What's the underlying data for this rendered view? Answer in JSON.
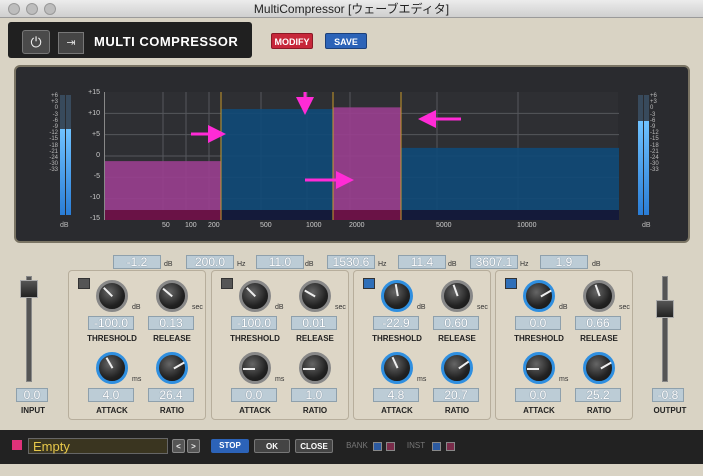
{
  "window": {
    "title": "MultiCompressor [ウェーブエディタ]"
  },
  "header": {
    "plugin_name": "MULTI COMPRESSOR",
    "modify_label": "MODIFY",
    "save_label": "SAVE",
    "power_icon": "power-icon",
    "dropdown_icon": "dropdown-icon"
  },
  "meter_scale": [
    "+6",
    "+3",
    "0",
    "-3",
    "-6",
    "-9",
    "-12",
    "-15",
    "-18",
    "-21",
    "-24",
    "-30",
    "-33"
  ],
  "meter_db": "dB",
  "input_level": 0.72,
  "output_level": 0.78,
  "graph": {
    "y_ticks": [
      "+15",
      "+10",
      "+5",
      "0",
      "-5",
      "-10",
      "-15"
    ],
    "x_ticks": [
      "50",
      "100",
      "200",
      "500",
      "1000",
      "2000",
      "5000",
      "10000"
    ],
    "band_levels_db": [
      -1.2,
      11.0,
      11.4,
      1.9
    ]
  },
  "crossovers": [
    {
      "gain": "-1.2",
      "gain_unit": "dB",
      "freq": "200.0",
      "freq_unit": "Hz"
    },
    {
      "gain": "11.0",
      "gain_unit": "dB",
      "freq": "1530.6",
      "freq_unit": "Hz"
    },
    {
      "gain": "11.4",
      "gain_unit": "dB",
      "freq": "3607.1",
      "freq_unit": "Hz"
    },
    {
      "gain": "1.9",
      "gain_unit": "dB"
    }
  ],
  "bands": [
    {
      "threshold": "-100.0",
      "release": "0.13",
      "attack": "4.0",
      "ratio": "26.4"
    },
    {
      "threshold": "-100.0",
      "release": "0.01",
      "attack": "0.0",
      "ratio": "1.0"
    },
    {
      "threshold": "-22.9",
      "release": "0.60",
      "attack": "4.8",
      "ratio": "20.7"
    },
    {
      "threshold": "0.0",
      "release": "0.66",
      "attack": "0.0",
      "ratio": "25.2"
    }
  ],
  "labels": {
    "threshold": "THRESHOLD",
    "release": "RELEASE",
    "attack": "ATTACK",
    "ratio": "RATIO",
    "db": "dB",
    "sec": "sec",
    "ms": "ms"
  },
  "input": {
    "label": "INPUT",
    "value": "0.0"
  },
  "output": {
    "label": "OUTPUT",
    "value": "-0.8"
  },
  "footer": {
    "preset_name": "Empty",
    "stop": "STOP",
    "ok": "OK",
    "close": "CLOSE",
    "bank": "BANK",
    "inst": "INST",
    "prev": "<",
    "next": ">"
  },
  "colors": {
    "band_fill": "#0f4a78",
    "highlight": "#9a3f8f",
    "accent_blue": "#2c63b8",
    "modify_red": "#c7273a",
    "annotation_pink": "#ff2bd6"
  }
}
